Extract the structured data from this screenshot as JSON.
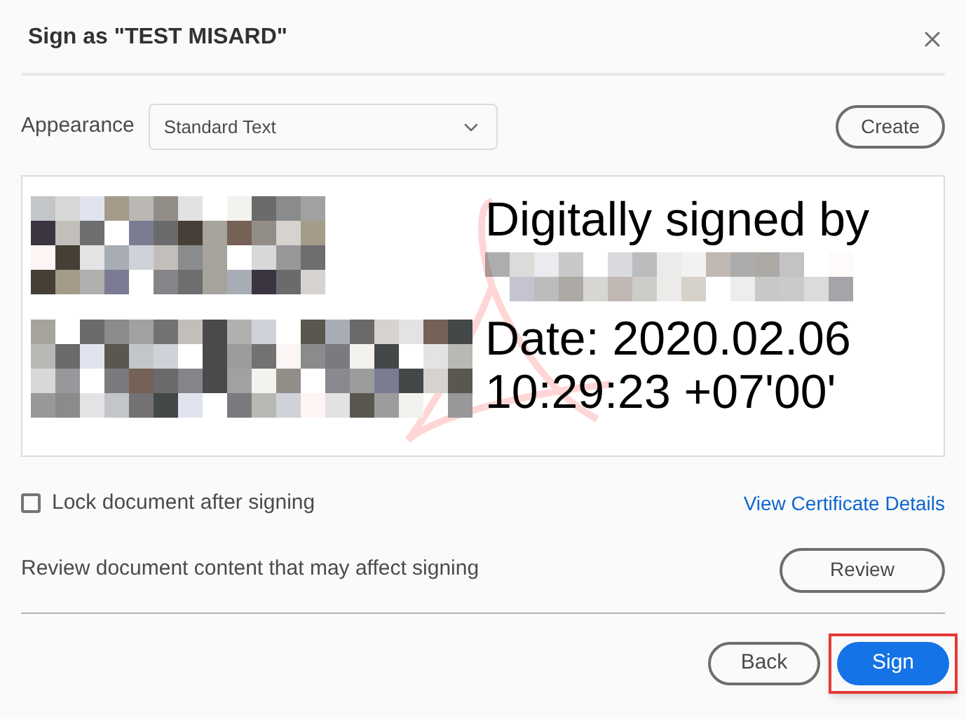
{
  "dialog": {
    "title": "Sign as \"TEST MISARD\""
  },
  "appearance": {
    "label": "Appearance",
    "value": "Standard Text",
    "create_button": "Create"
  },
  "preview": {
    "heading": "Digitally signed by",
    "date_lines": [
      "Date: 2020.02.06",
      "10:29:23 +07'00'"
    ]
  },
  "lock_option": {
    "label": "Lock document after signing",
    "checked": false
  },
  "certificate_link": "View Certificate Details",
  "review": {
    "text": "Review document content that may affect signing",
    "button": "Review"
  },
  "buttons": [
    {
      "label": "Back",
      "kind": "secondary",
      "highlighted": false
    },
    {
      "label": "Sign",
      "kind": "primary",
      "highlighted": true
    }
  ]
}
